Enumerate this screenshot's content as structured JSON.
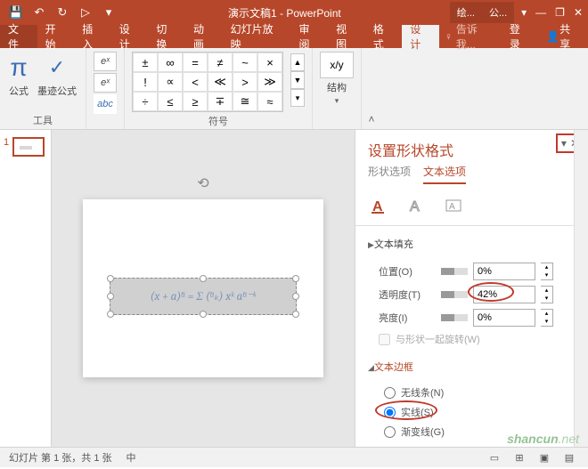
{
  "title": "演示文稿1 - PowerPoint",
  "context_tabs": [
    "绘...",
    "公..."
  ],
  "win": {
    "restore": "❐",
    "min": "—",
    "close": "✕",
    "ribbon_opts": "▾"
  },
  "qat": {
    "save": "💾",
    "undo": "↶",
    "redo": "↻",
    "start": "▷",
    "more": "▾"
  },
  "menu": {
    "file": "文件",
    "home": "开始",
    "insert": "插入",
    "design": "设计",
    "transition": "切换",
    "animation": "动画",
    "slideshow": "幻灯片放映",
    "review": "审阅",
    "view": "视图",
    "format": "格式",
    "design2": "设计",
    "tell_me": "告诉我...",
    "login": "登录",
    "share": "共享"
  },
  "ribbon": {
    "tools": {
      "label": "工具",
      "formula": "公式",
      "ink": "墨迹公式"
    },
    "conv": {
      "pro": "eˣ",
      "lin": "eˣ",
      "abc": "abc"
    },
    "symbols": {
      "label": "符号",
      "cells": [
        "±",
        "∞",
        "=",
        "≠",
        "~",
        "×",
        "!",
        "∝",
        "<",
        "≪",
        ">",
        "≫",
        "÷",
        "≤",
        "≥",
        "∓",
        "≅",
        "≈"
      ]
    },
    "struct": {
      "label": "结构",
      "frac": "x/y"
    }
  },
  "thumb": {
    "num": "1"
  },
  "equation": "(x + a)ⁿ = Σ (ⁿₖ) xᵏ aⁿ⁻ᵏ",
  "pane": {
    "title": "设置形状格式",
    "tab_shape": "形状选项",
    "tab_text": "文本选项",
    "section_fill": "文本填充",
    "position": "位置(O)",
    "position_val": "0%",
    "transparency": "透明度(T)",
    "transparency_val": "42%",
    "brightness": "亮度(I)",
    "brightness_val": "0%",
    "rotate_with": "与形状一起旋转(W)",
    "section_border": "文本边框",
    "no_line": "无线条(N)",
    "solid_line": "实线(S)",
    "gradient_line": "渐变线(G)"
  },
  "status": {
    "slide_info": "幻灯片 第 1 张，共 1 张",
    "lang": "中"
  },
  "watermark": {
    "brand": "shancun",
    "suffix": ".net"
  }
}
